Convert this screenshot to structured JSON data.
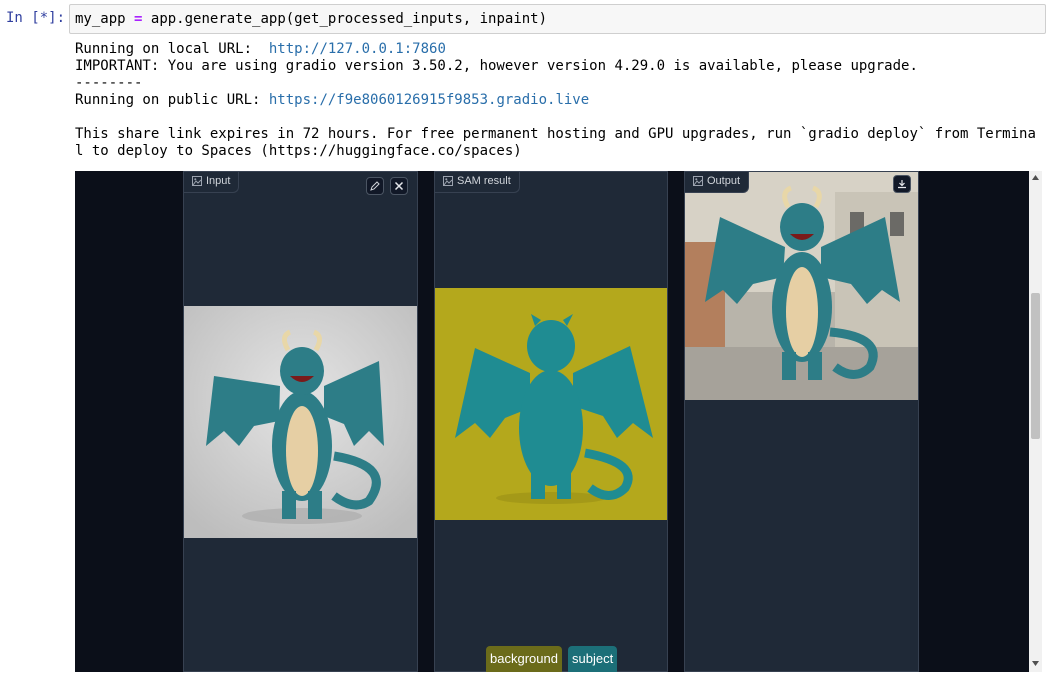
{
  "cell": {
    "prompt": "In [*]:",
    "code_var": "my_app",
    "code_op": "=",
    "code_call": "app.generate_app(get_processed_inputs, inpaint)"
  },
  "output": {
    "local_prefix": "Running on local URL:  ",
    "local_url": "http://127.0.0.1:7860",
    "important": "IMPORTANT: You are using gradio version 3.50.2, however version 4.29.0 is available, please upgrade.",
    "divider": "--------",
    "public_prefix": "Running on public URL: ",
    "public_url": "https://f9e8060126915f9853.gradio.live",
    "share_line1": "This share link expires in 72 hours. For free permanent hosting and GPU upgrades, run `gradio deploy` from Termina",
    "share_line2": "l to deploy to Spaces (https://huggingface.co/spaces)"
  },
  "gradio": {
    "input_label": "Input",
    "sam_label": "SAM result",
    "output_label": "Output",
    "legend": [
      {
        "label": "background",
        "color": "#6b6b1a"
      },
      {
        "label": "subject",
        "color": "#1c6f78"
      }
    ]
  },
  "colors": {
    "dragon": "#2d7d87",
    "sam_bg": "#b4a81c",
    "input_bg": "#cfcfcf"
  }
}
